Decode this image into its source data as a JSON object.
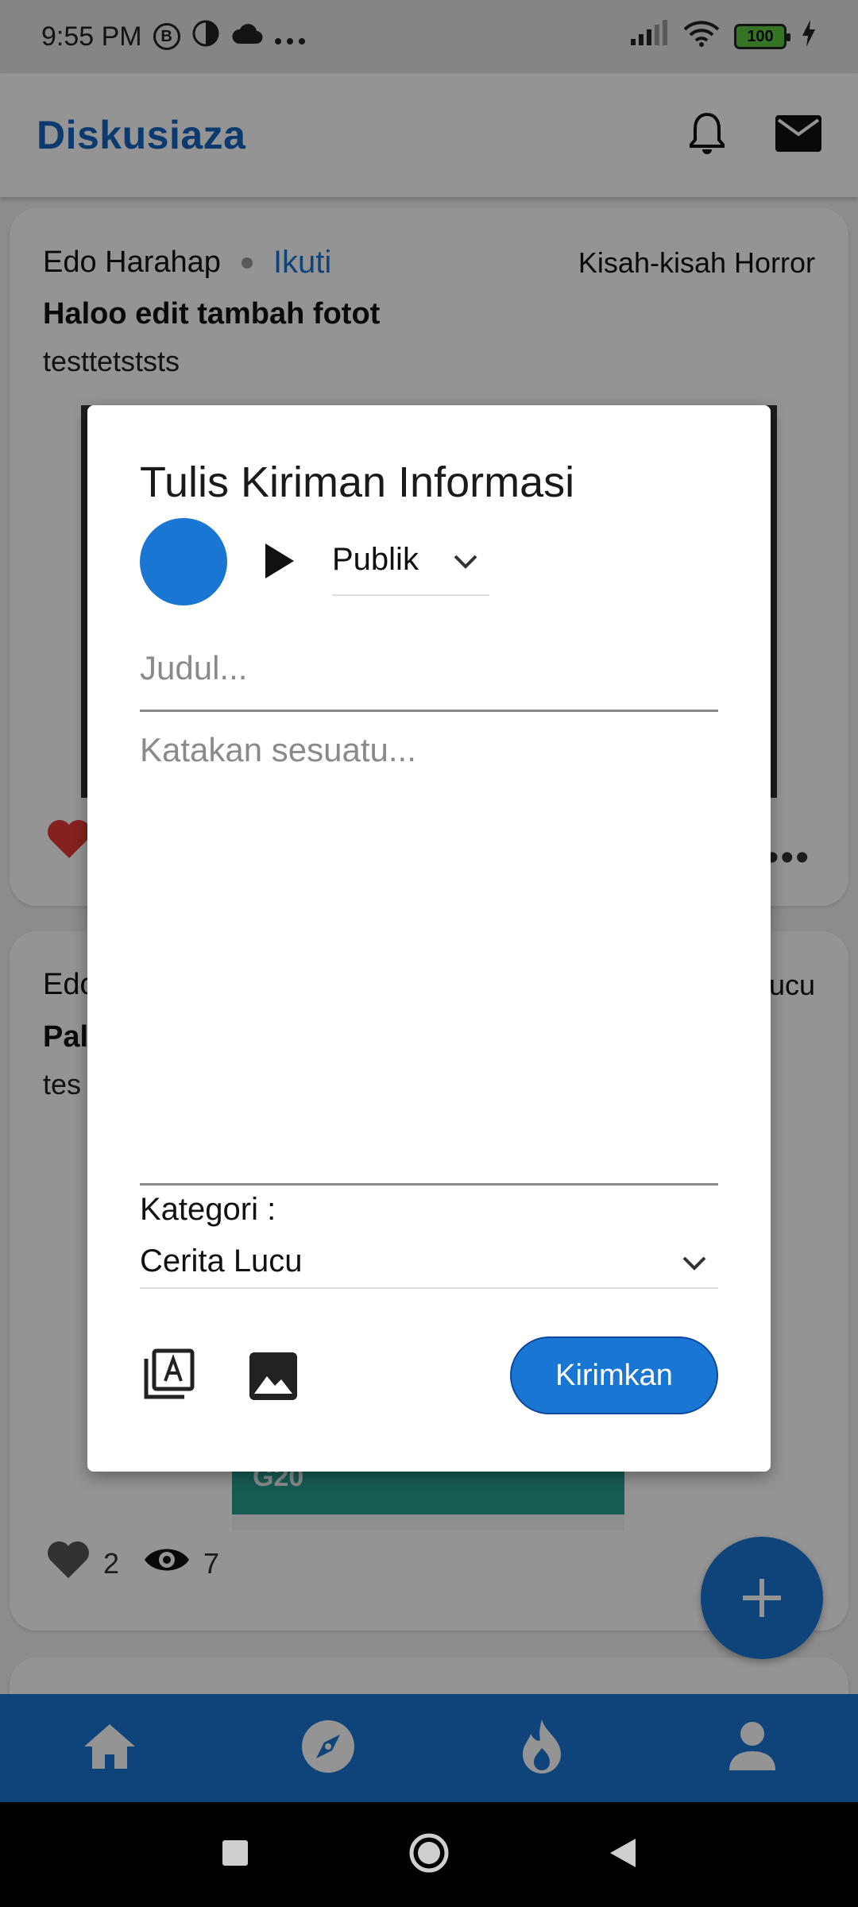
{
  "status_bar": {
    "time": "9:55 PM",
    "icon_b": "B",
    "battery": "100"
  },
  "app_bar": {
    "brand": "Diskusiaza"
  },
  "feed": {
    "post1": {
      "author": "Edo Harahap",
      "follow": "Ikuti",
      "category": "Kisah-kisah Horror",
      "title": "Haloo edit tambah fotot",
      "body": "testtetststs"
    },
    "post2": {
      "author": "Edo Harahap",
      "category": "Cerita Lucu",
      "title": "Pal",
      "body": "tes",
      "image_text": "G20",
      "likes": "2",
      "views": "7"
    }
  },
  "dialog": {
    "title": "Tulis Kiriman Informasi",
    "privacy": "Publik",
    "title_placeholder": "Judul...",
    "body_placeholder": "Katakan sesuatu...",
    "category_label": "Kategori :",
    "category_value": "Cerita Lucu",
    "submit_label": "Kirimkan"
  },
  "colors": {
    "primary": "#1976d2",
    "brand_text": "#1565c0",
    "like_red": "#e53935"
  },
  "icons": {
    "top_bar": [
      "bell-icon",
      "mail-icon"
    ],
    "bottom_nav": [
      "home-icon",
      "compass-icon",
      "fire-icon",
      "person-icon"
    ],
    "dialog_tools": [
      "text-library-icon",
      "image-icon"
    ]
  }
}
